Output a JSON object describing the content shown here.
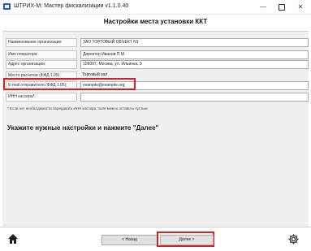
{
  "window": {
    "title": "ШТРИХ-М: Мастер фискализации v1.1.0.40",
    "minimize": "—",
    "close": "✕"
  },
  "header": {
    "title": "Настройки места установки ККТ"
  },
  "form": {
    "rows": [
      {
        "label": "Наименование организации:",
        "value": "ЗАО ТОРГОВЫЙ ОБЪЕКТ N1"
      },
      {
        "label": "Имя оператора:",
        "value": "Директор Иванов П.М."
      },
      {
        "label": "Адрес организации:",
        "value": "109097, Москва, ул. Ильинка, 9"
      },
      {
        "label": "Место расчетов (ФФД 1.05):",
        "value": "Торговый зал"
      },
      {
        "label": "E-mail отправителя (ФФД 1.05):",
        "value": "example@example.org"
      },
      {
        "label": "ИНН кассира*:",
        "value": ""
      }
    ],
    "note": "* Если нет необходимости передавать ИНН кассира, поле можно оставить пустым"
  },
  "instruction": "Укажите нужные настройки и нажмите  \"Далее\"",
  "footer": {
    "back_label": "< Назад",
    "next_label": "Далее >"
  },
  "colors": {
    "highlight": "#d42020",
    "panel": "#f0f0f0"
  },
  "icons": {
    "home": "home-icon",
    "settings": "gear-icon",
    "app": "app-icon"
  }
}
